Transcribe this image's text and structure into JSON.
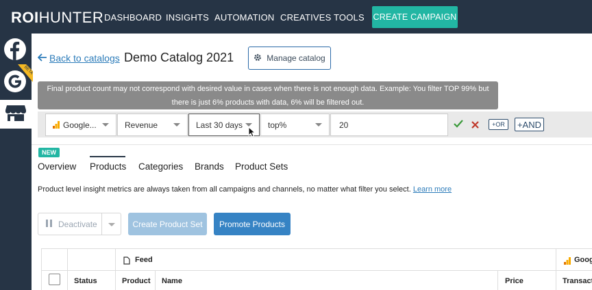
{
  "brand": {
    "logo_bold": "ROI",
    "logo_light": "HUNTER"
  },
  "nav": {
    "items": [
      "DASHBOARD",
      "INSIGHTS",
      "AUTOMATION",
      "CREATIVES",
      "TOOLS"
    ],
    "cta": "CREATE CAMPAIGN"
  },
  "sidebar": {
    "beta_label": "BETA"
  },
  "header": {
    "back_link": "Back to catalogs",
    "title": "Demo Catalog 2021",
    "manage_button": "Manage catalog"
  },
  "tooltip": {
    "line1": "Final product count may not correspond with desired value in cases when there is not enough data. Example: You filter TOP 99% but",
    "line2": "there is just 6% products with data, 6% will be filtered out."
  },
  "filter": {
    "source": "Google...",
    "metric": "Revenue",
    "period": "Last 30 days",
    "operator": "top%",
    "value": "20",
    "or_label": "+OR",
    "and_label": "+AND"
  },
  "tabs": {
    "new_badge": "NEW",
    "items": [
      "Overview",
      "Products",
      "Categories",
      "Brands",
      "Product Sets"
    ],
    "active": "Products"
  },
  "info": {
    "text": "Product level insight metrics are always taken from all campaigns and channels, no matter what filter you select.",
    "link": "Learn more"
  },
  "actions": {
    "deactivate": "Deactivate",
    "create_set": "Create Product Set",
    "promote": "Promote Products"
  },
  "table": {
    "group_feed": "Feed",
    "group_google": "Goog",
    "columns": [
      "Status",
      "Product",
      "Name",
      "Price",
      "Transacti"
    ]
  },
  "colors": {
    "nav_bg": "#263445",
    "accent": "#22b6a3",
    "link": "#2b7bb9",
    "primary": "#3683c4"
  }
}
